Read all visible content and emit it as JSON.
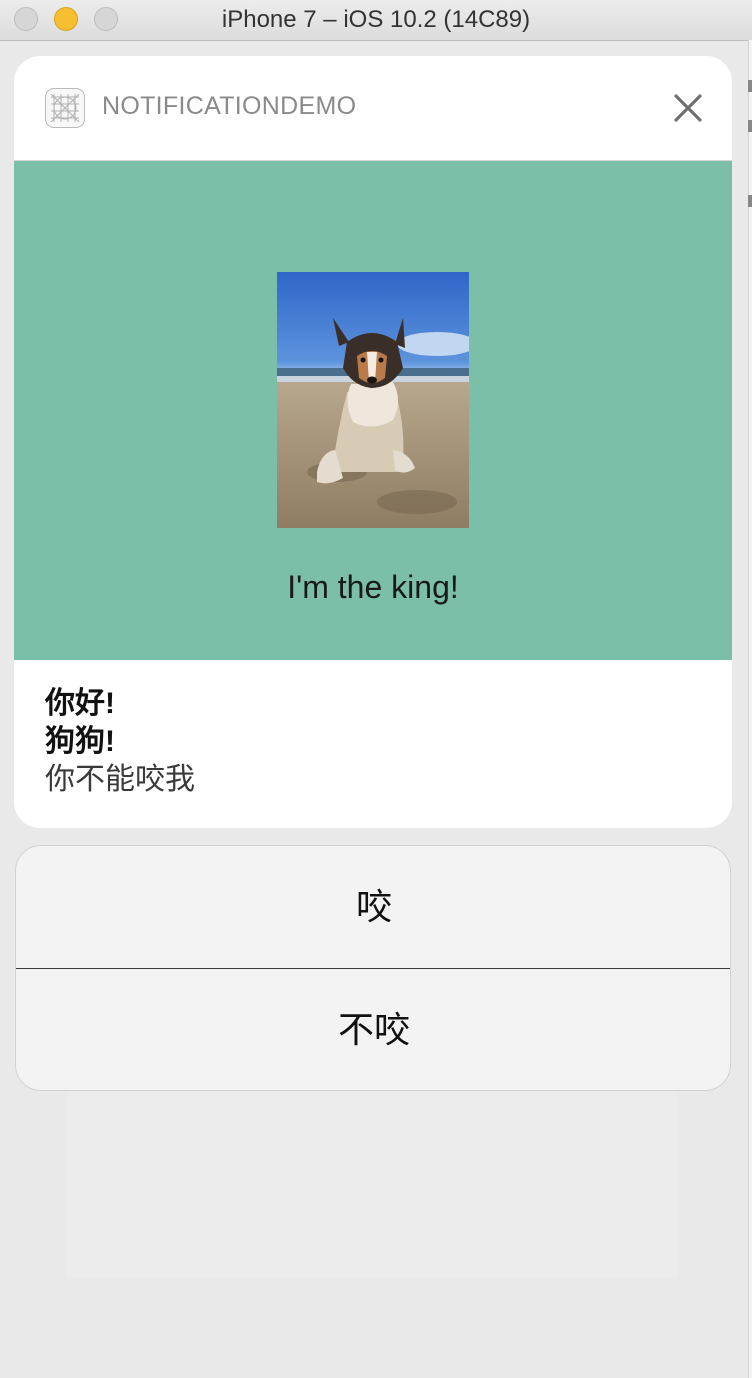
{
  "window": {
    "title": "iPhone 7 – iOS 10.2 (14C89)"
  },
  "notification": {
    "app_name": "NOTIFICATIONDEMO",
    "app_icon": "app-grid-icon",
    "close_icon": "close-icon",
    "caption": "I'm the king!",
    "title": "你好!",
    "subtitle": "狗狗!",
    "body": "你不能咬我",
    "media_background": "#7bbfa9"
  },
  "actions": [
    {
      "label": "咬"
    },
    {
      "label": "不咬"
    }
  ]
}
